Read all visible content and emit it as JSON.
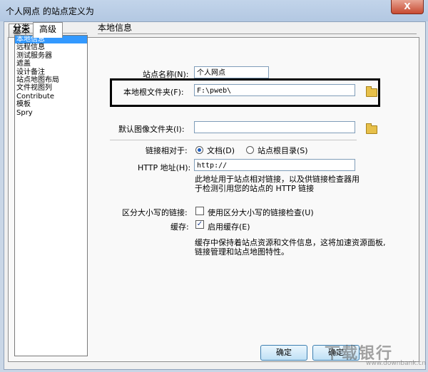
{
  "window": {
    "title": "个人网点 的站点定义为",
    "close_glyph": "X"
  },
  "tabs": [
    {
      "label": "基本",
      "active": false
    },
    {
      "label": "高级",
      "active": true
    }
  ],
  "category": {
    "heading": "分类",
    "items": [
      "本地信息",
      "远程信息",
      "测试服务器",
      "遮盖",
      "设计备注",
      "站点地图布局",
      "文件视图列",
      "Contribute",
      "模板",
      "Spry"
    ],
    "selected": "本地信息"
  },
  "section": {
    "heading": "本地信息"
  },
  "form": {
    "site_name": {
      "label": "站点名称(N):",
      "value": "个人网点"
    },
    "local_root": {
      "label": "本地根文件夹(F):",
      "value": "F:\\pweb\\"
    },
    "default_images": {
      "label": "默认图像文件夹(I):",
      "value": ""
    },
    "links_relative": {
      "label": "链接相对于:",
      "options": [
        {
          "label": "文档(D)",
          "checked": true
        },
        {
          "label": "站点根目录(S)",
          "checked": false
        }
      ]
    },
    "http_address": {
      "label": "HTTP 地址(H):",
      "value": "http://",
      "note": "此地址用于站点相对链接，以及供链接检查器用于检测引用您的站点的 HTTP 链接"
    },
    "case_sensitive": {
      "label": "区分大小写的链接:",
      "checkbox_label": "使用区分大小写的链接检查(U)",
      "checked": false
    },
    "cache": {
      "label": "缓存:",
      "checkbox_label": "启用缓存(E)",
      "checked": true,
      "note": "缓存中保持着站点资源和文件信息，这将加速资源面板,链接管理和站点地图特性。"
    }
  },
  "buttons": {
    "ok": "确定",
    "ok2": "确定"
  },
  "watermark": {
    "text": "下载银行",
    "sub": "www.downbank.cn"
  },
  "colors": {
    "selection": "#3399ff",
    "titlebar": "#b9cde6",
    "close": "#c74a31"
  }
}
